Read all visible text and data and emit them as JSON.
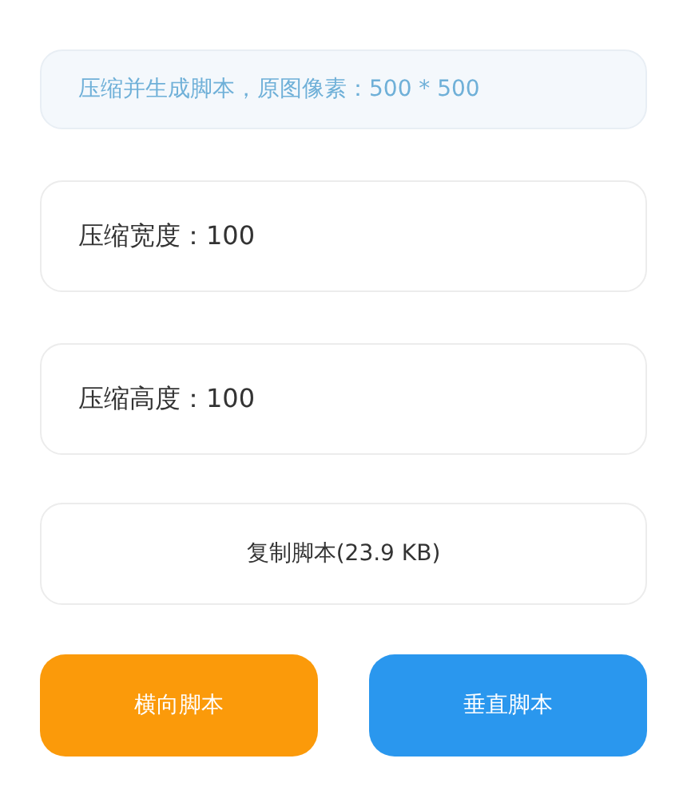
{
  "info": {
    "text": "压缩并生成脚本，原图像素：500 * 500"
  },
  "fields": [
    {
      "label": "压缩宽度：100"
    },
    {
      "label": "压缩高度：100"
    }
  ],
  "copy_button": {
    "label": "复制脚本(23.9 KB)"
  },
  "actions": [
    {
      "label": "横向脚本",
      "color": "#fb9a0a"
    },
    {
      "label": "垂直脚本",
      "color": "#2a97ee"
    }
  ]
}
